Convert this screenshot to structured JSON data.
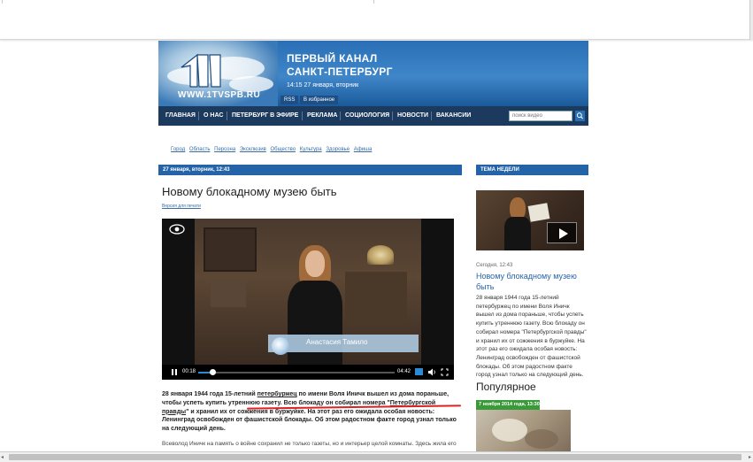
{
  "header": {
    "channel_line1": "ПЕРВЫЙ КАНАЛ",
    "channel_line2": "САНКТ-ПЕТЕРБУРГ",
    "datetime": "14:15  27 января, вторник",
    "site_url": "WWW.1TVSPB.RU",
    "rss_label": "RSS",
    "favorites_label": "В избранное",
    "brand_color": "#2a6fb5"
  },
  "nav": {
    "items": [
      "ГЛАВНАЯ",
      "О НАС",
      "ПЕТЕРБУРГ В ЭФИРЕ",
      "РЕКЛАМА",
      "СОЦИОЛОГИЯ",
      "НОВОСТИ",
      "ВАКАНСИИ"
    ],
    "search_placeholder": "поиск видео",
    "bg_color": "#1c3a5e"
  },
  "subnav": {
    "items": [
      "Город",
      "Область",
      "Персона",
      "Эксклюзив",
      "Общество",
      "Культура",
      "Здоровье",
      "Афиша"
    ]
  },
  "article": {
    "date_bar": "27 января, вторник, 12:43",
    "title": "Новому блокадному музею быть",
    "print_link": "Версия для печати",
    "lead_part1": "28 января 1944 года 15-летний ",
    "lead_part2": "петербуржец",
    "lead_part3": " по имени Воля Иничк вышел из дома пораньше, чтобы успеть купить утреннюю газету. Всю блокаду он собирал номера \"",
    "lead_part4": "Петербургской правды",
    "lead_part5": "\" и хранил их от сожжения в буржуйке. На этот раз его ожидала особая новость: Ленинград освобожден от фашистской блокады. Об этом радостном факте город узнал только на следующий день.",
    "body": "Всеволод Иничк на память о войне сохранил не только газеты, но и интерьер целой комнаты. Здесь жила его"
  },
  "video": {
    "caption_name": "Анастасия Тамило",
    "time_current": "00:18",
    "time_total": "04:42",
    "progress": 0.07
  },
  "sidebar": {
    "theme_header": "ТЕМА НЕДЕЛИ",
    "theme_date": "Сегодня, 12:43",
    "theme_title": "Новому блокадному музею быть",
    "theme_text": "28 января 1944 года 15-летний петербуржец по имени Воля Иничк вышел из дома пораньше, чтобы успеть купить утреннюю газету. Всю блокаду он собирал номера \"Петербургской правды\" и хранил их от сожжения в буржуйке. На этот раз его ожидала особая новость: Ленинград освобожден от фашистской блокады. Об этом радостном факте город узнал только на следующий день.",
    "popular_heading": "Популярное",
    "popular_date": "7 ноября 2014 года, 13:30",
    "popular_badge_color": "#3a9a3a"
  }
}
